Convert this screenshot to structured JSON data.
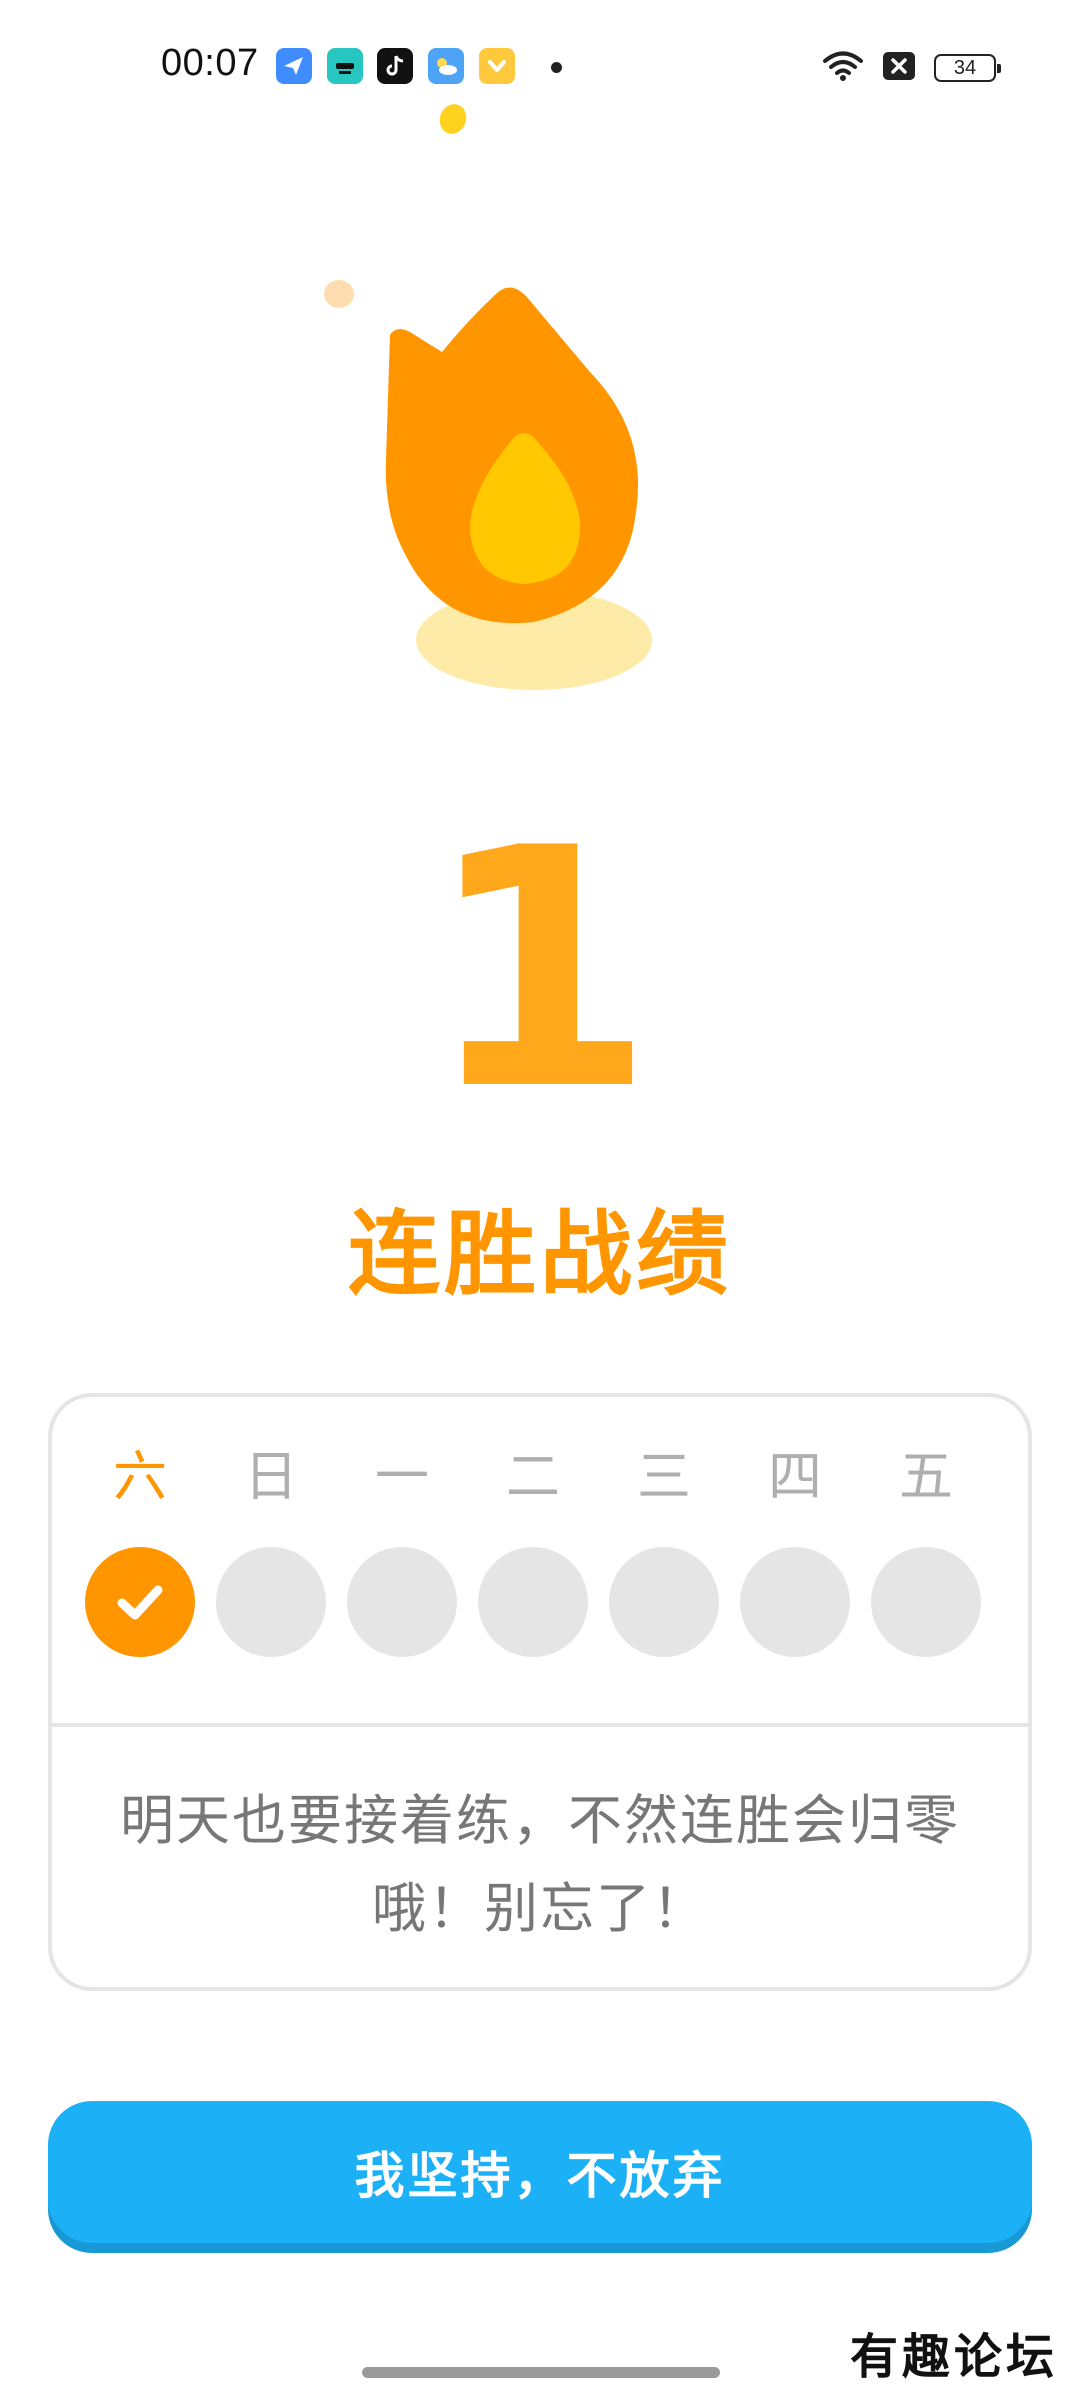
{
  "status_bar": {
    "time": "00:07",
    "battery": "34",
    "app_icons": [
      "bird-app-icon",
      "magic-app-icon",
      "tiktok-icon",
      "weather-icon",
      "chevron-app-icon"
    ],
    "icons": [
      "wifi-icon",
      "no-sim-icon",
      "battery-icon"
    ]
  },
  "hero": {
    "streak_count": "1",
    "title": "连胜战绩",
    "icon": "flame-icon"
  },
  "week": {
    "days": [
      {
        "label": "六",
        "completed": true
      },
      {
        "label": "日",
        "completed": false
      },
      {
        "label": "一",
        "completed": false
      },
      {
        "label": "二",
        "completed": false
      },
      {
        "label": "三",
        "completed": false
      },
      {
        "label": "四",
        "completed": false
      },
      {
        "label": "五",
        "completed": false
      }
    ],
    "message_line1": "明天也要接着练，不然连胜会归零",
    "message_line2": "哦！别忘了！"
  },
  "button": {
    "label": "我坚持，不放弃"
  },
  "watermark": "有趣论坛",
  "colors": {
    "orange": "#FF9600",
    "orange_light": "#FFA81C",
    "flame_core": "#FFC800",
    "blue": "#1CB0F6",
    "gray_border": "#E5E5E5",
    "gray_text": "#777777"
  }
}
